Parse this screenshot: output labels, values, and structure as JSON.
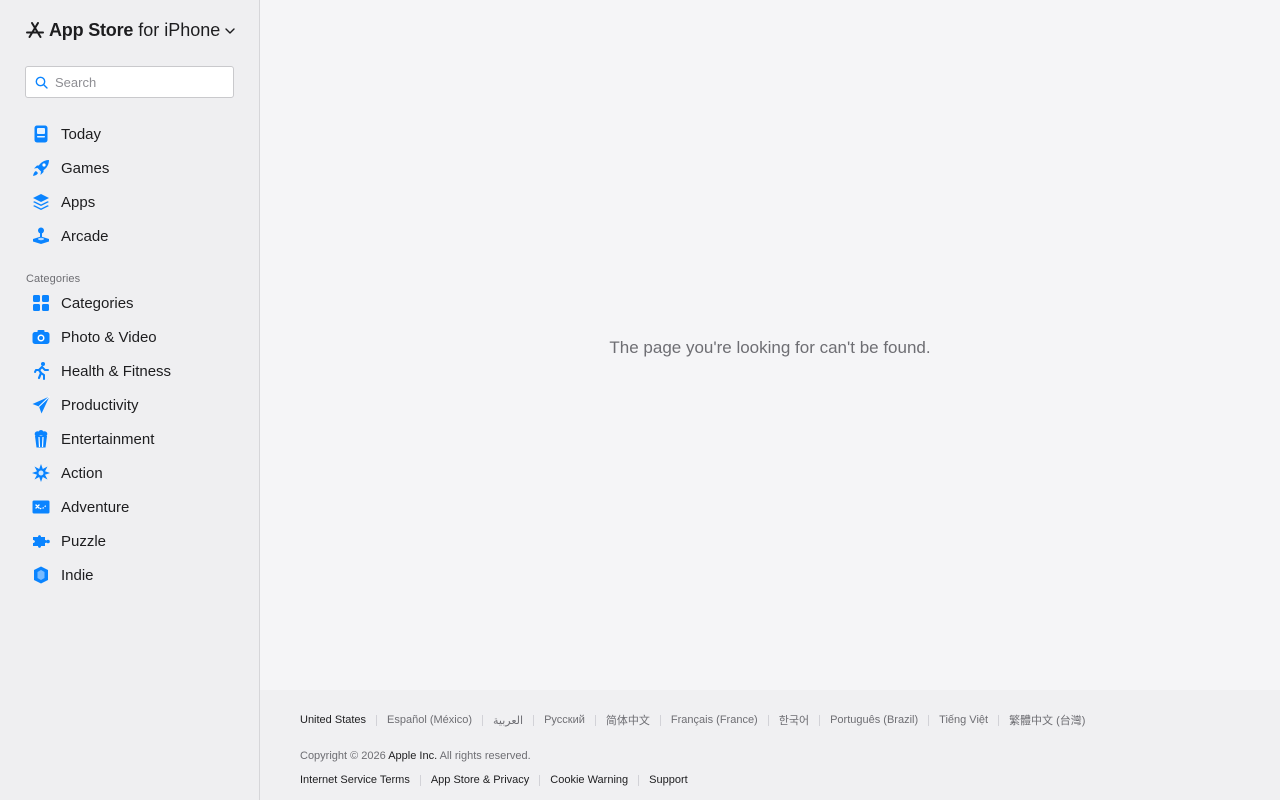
{
  "brand": {
    "name": "App Store",
    "platform": "for iPhone"
  },
  "search": {
    "placeholder": "Search",
    "value": ""
  },
  "nav": [
    {
      "label": "Today",
      "icon": "today-icon"
    },
    {
      "label": "Games",
      "icon": "rocket-icon"
    },
    {
      "label": "Apps",
      "icon": "layers-icon"
    },
    {
      "label": "Arcade",
      "icon": "joystick-icon"
    }
  ],
  "categories": {
    "title": "Categories",
    "items": [
      {
        "label": "Categories",
        "icon": "grid-icon"
      },
      {
        "label": "Photo & Video",
        "icon": "camera-icon"
      },
      {
        "label": "Health & Fitness",
        "icon": "running-figure-icon"
      },
      {
        "label": "Productivity",
        "icon": "paper-plane-icon"
      },
      {
        "label": "Entertainment",
        "icon": "popcorn-icon"
      },
      {
        "label": "Action",
        "icon": "burst-icon"
      },
      {
        "label": "Adventure",
        "icon": "map-icon"
      },
      {
        "label": "Puzzle",
        "icon": "puzzle-piece-icon"
      },
      {
        "label": "Indie",
        "icon": "gem-icon"
      }
    ]
  },
  "main": {
    "message": "The page you're looking for can't be found."
  },
  "footer": {
    "languages": [
      "United States",
      "Español (México)",
      "العربية",
      "Русский",
      "简体中文",
      "Français (France)",
      "한국어",
      "Português (Brazil)",
      "Tiếng Việt",
      "繁體中文 (台灣)"
    ],
    "copyright_prefix": "Copyright © 2026",
    "company": "Apple Inc.",
    "copyright_suffix": "All rights reserved.",
    "links": [
      "Internet Service Terms",
      "App Store & Privacy",
      "Cookie Warning",
      "Support"
    ]
  },
  "colors": {
    "accent": "#0a84ff",
    "sidebar_bg": "#efeff1",
    "page_bg": "#f5f5f7",
    "footer_bg": "#f0f0f2"
  }
}
